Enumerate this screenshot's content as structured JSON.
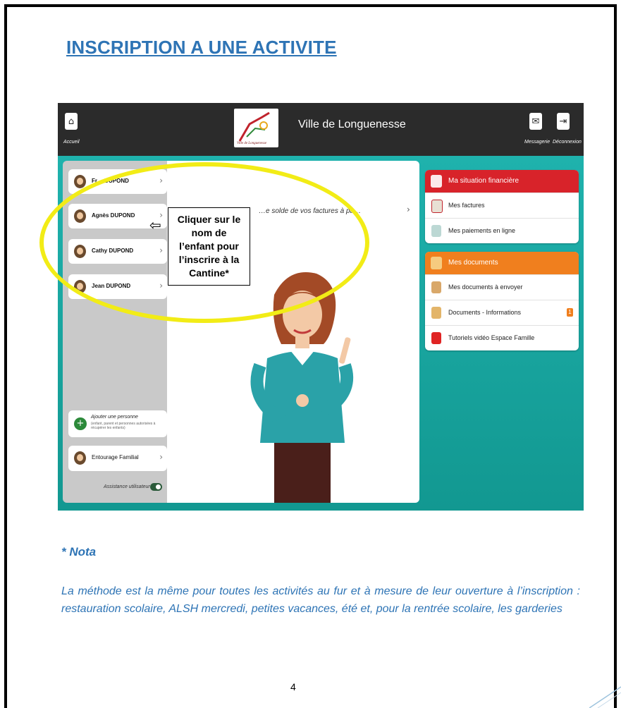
{
  "document": {
    "title": "INSCRIPTION A UNE ACTIVITE",
    "nota_heading": "* Nota",
    "nota_body": "La méthode est la même pour toutes les activités au fur et à mesure de leur ouverture à  l’inscription : restauration scolaire, ALSH mercredi, petites vacances, été et, pour la rentrée scolaire, les garderies",
    "page_number": "4"
  },
  "app": {
    "city_name": "Ville de Longuenesse",
    "logo_caption": "Ville de Longuenesse",
    "topbar": {
      "home_label": "Accueil",
      "messaging_label": "Messagerie",
      "logout_label": "Déconnexion"
    },
    "people": [
      {
        "name": "Fr… DUPOND"
      },
      {
        "name": "Agnès DUPOND"
      },
      {
        "name": "Cathy DUPOND"
      },
      {
        "name": "Jean DUPOND"
      }
    ],
    "add_person": {
      "title": "Ajouter une personne",
      "subtitle": "(enfant, parent et personnes autorisées à récupérer les enfants)"
    },
    "family_circle": "Entourage Familial",
    "assistant_label": "Assistance utilisateur :",
    "assistant_enabled": true,
    "center_text": "…e solde de vos factures à pa…",
    "finance_card": {
      "title": "Ma situation financière",
      "items": [
        "Mes factures",
        "Mes paiements en ligne"
      ]
    },
    "documents_card": {
      "title": "Mes documents",
      "items": [
        "Mes documents à envoyer",
        "Documents - Informations",
        "Tutoriels vidéo Espace Famille"
      ],
      "info_badge": "1"
    },
    "colors": {
      "finance_header": "#d8232a",
      "documents_header": "#f07f1e",
      "teal_background": "#19a39e",
      "highlight": "#f2ec16"
    }
  },
  "annotation": {
    "callout": "Cliquer sur le\nnom de\nl’enfant pour\nl’inscrire à la\nCantine*",
    "arrow": "⇦"
  }
}
